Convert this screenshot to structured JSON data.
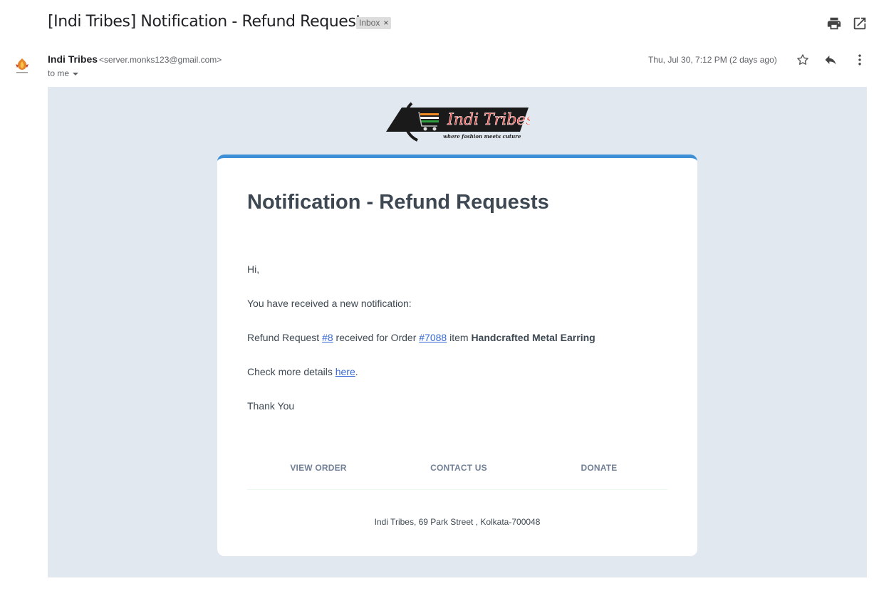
{
  "subject": {
    "title": "[Indi Tribes] Notification - Refund Requests",
    "label": "Inbox",
    "label_close": "×"
  },
  "toolbar": {
    "icons": [
      "print-icon",
      "open-in-new-window-icon"
    ]
  },
  "sender": {
    "name": "Indi Tribes",
    "email": "<server.monks123@gmail.com>",
    "recipient": "to me",
    "timestamp": "Thu, Jul 30, 7:12 PM (2 days ago)",
    "actions": [
      "star-icon",
      "reply-icon",
      "more-vert-icon"
    ]
  },
  "email": {
    "logo": {
      "brand": "Indi Tribes",
      "tagline": "where fashion meets cuture"
    },
    "title": "Notification - Refund Requests",
    "greeting": "Hi,",
    "intro": "You have received a new notification:",
    "refund": {
      "prefix": "Refund Request ",
      "request_link": "#8",
      "middle": " received for Order ",
      "order_link": "#7088",
      "item_prefix": " item ",
      "item_name": "Handcrafted Metal Earring"
    },
    "details": {
      "prefix": "Check more details ",
      "link": "here",
      "suffix": "."
    },
    "closing": "Thank You",
    "footer_links": [
      "VIEW ORDER",
      "CONTACT US",
      "DONATE"
    ],
    "address": "Indi Tribes, 69 Park Street , Kolkata-700048"
  },
  "colors": {
    "body_background": "#e2e8f0",
    "card_accent": "#3d8fd6",
    "link": "#3869d4",
    "heading_text": "#3d4852",
    "footer_link": "#718096"
  }
}
